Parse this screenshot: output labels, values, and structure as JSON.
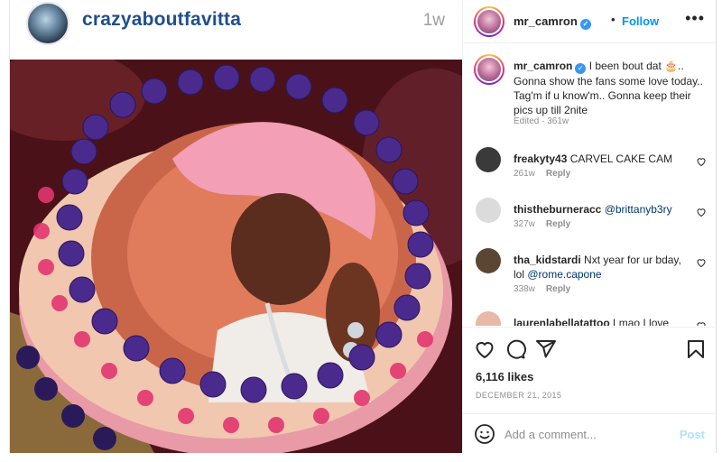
{
  "repost": {
    "username": "crazyaboutfavitta",
    "time": "1w"
  },
  "post": {
    "author": "mr_camron",
    "follow_label": "Follow",
    "more_label": "•••",
    "caption_author": "mr_camron",
    "caption_text": " I been bout dat 🎂.. Gonna show the fans some love today.. Tag'm if u know'm.. Gonna keep their pics up till 2nite",
    "caption_meta": "Edited · 361w",
    "comments": [
      {
        "user": "freakyty43",
        "text": " CARVEL CAKE CAM",
        "link": "",
        "time": "261w",
        "reply": "Reply",
        "avatar_color": "#3a3a3a"
      },
      {
        "user": "thistheburneracc",
        "text": " ",
        "link": "@brittanyb3ry",
        "time": "327w",
        "reply": "Reply",
        "avatar_color": "#dbdbdb"
      },
      {
        "user": "tha_kidstardi",
        "text": " Nxt year for ur bday, lol ",
        "link": "@rome.capone",
        "time": "338w",
        "reply": "Reply",
        "avatar_color": "#5a4632"
      },
      {
        "user": "laurenlabellatattoo",
        "text": " Lmao I love",
        "link": "",
        "time": "",
        "reply": "",
        "avatar_color": "#e8b8a8"
      }
    ],
    "likes": "6,116 likes",
    "date": "DECEMBER 21, 2015",
    "add_comment_placeholder": "Add a comment...",
    "post_label": "Post"
  },
  "icons": {
    "heart": "heart-icon",
    "comment": "comment-icon",
    "share": "share-icon",
    "bookmark": "bookmark-icon",
    "emoji": "emoji-icon",
    "verified": "verified-badge-icon"
  },
  "colors": {
    "link_blue": "#0095f6",
    "left_username": "#1f4e8f",
    "frosting_purple": "#4a2a8c",
    "frosting_pink": "#e2366f"
  }
}
